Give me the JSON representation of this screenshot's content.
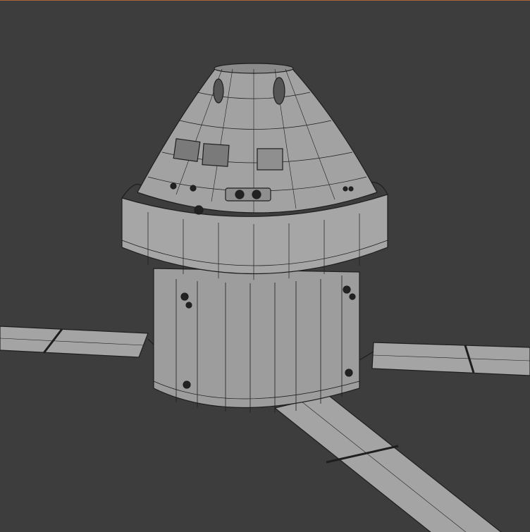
{
  "viewport": {
    "background_color": "#3d3d3d",
    "active_border_color": "#b0603a",
    "model_fill": "#9a9a9a",
    "wire_color": "#1e1e1e",
    "subject": "spacecraft-model"
  }
}
